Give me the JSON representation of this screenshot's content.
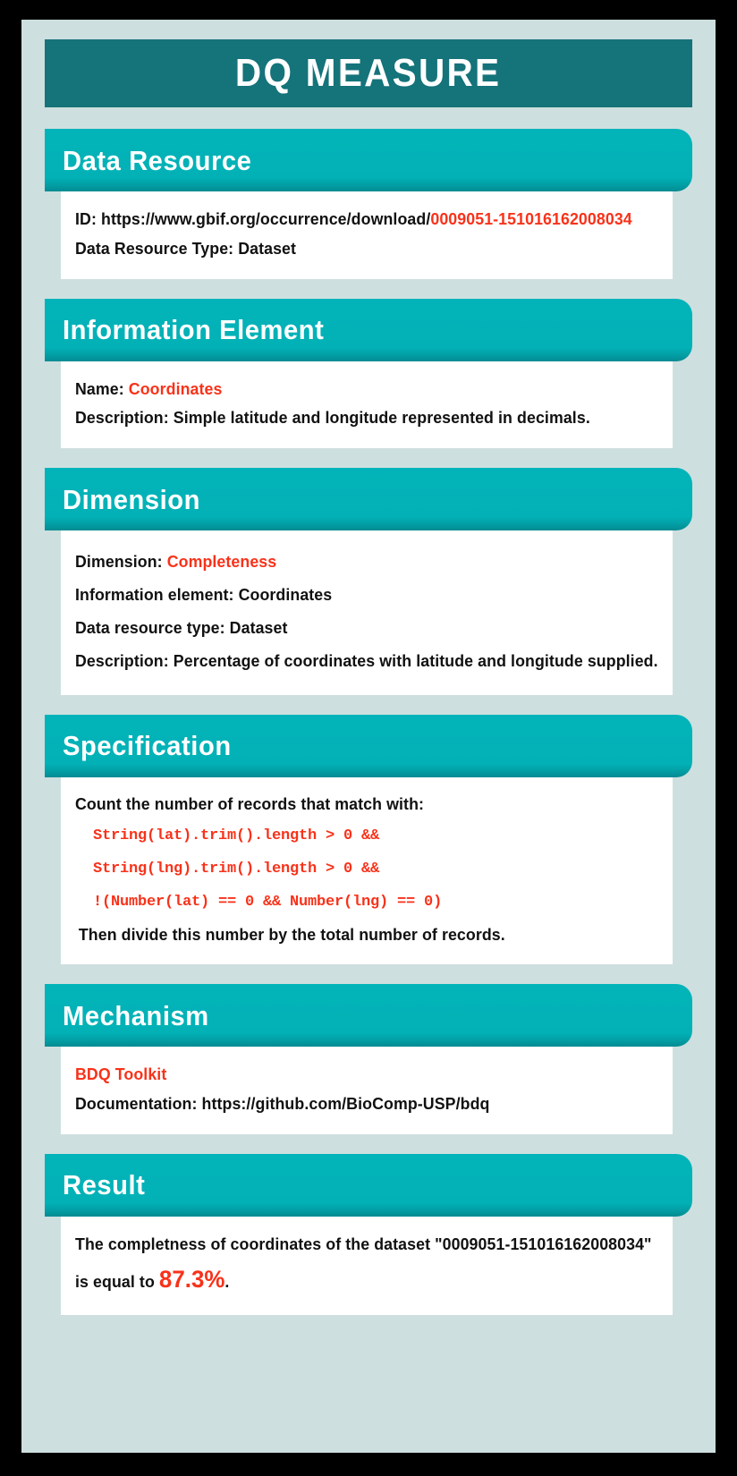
{
  "title": "DQ MEASURE",
  "colors": {
    "title_banner": "#15737a",
    "section_header": "#02b2b7",
    "card_background": "#cedfdf",
    "accent_red": "#f8321a",
    "body_background": "#ffffff",
    "frame": "#000000"
  },
  "sections": {
    "data_resource": {
      "header": "Data Resource",
      "id_label": "ID: ",
      "id_prefix": "https://www.gbif.org/occurrence/download/",
      "id_value": "0009051-151016162008034",
      "type_line": "Data Resource Type: Dataset"
    },
    "information_element": {
      "header": "Information Element",
      "name_label": "Name: ",
      "name_value": "Coordinates",
      "description_line": "Description: Simple latitude and longitude represented in decimals."
    },
    "dimension": {
      "header": "Dimension",
      "dimension_label": "Dimension: ",
      "dimension_value": "Completeness",
      "information_element_line": "Information element: Coordinates",
      "data_resource_type_line": "Data resource type: Dataset",
      "description_line": "Description: Percentage of coordinates with latitude and longitude supplied."
    },
    "specification": {
      "header": "Specification",
      "intro": "Count the number of records that match with:",
      "code": [
        "String(lat).trim().length > 0 &&",
        "String(lng).trim().length > 0 &&",
        "!(Number(lat) == 0 && Number(lng) == 0)"
      ],
      "outro": " Then divide this number by the total number of records."
    },
    "mechanism": {
      "header": "Mechanism",
      "toolkit_name": "BDQ Toolkit",
      "documentation_line": "Documentation: https://github.com/BioComp-USP/bdq"
    },
    "result": {
      "header": "Result",
      "sentence_part1": "The completness of coordinates of the dataset \"0009051-151016162008034\"",
      "sentence_part2": "is equal to ",
      "value": "87.3%",
      "sentence_part3": "."
    }
  }
}
